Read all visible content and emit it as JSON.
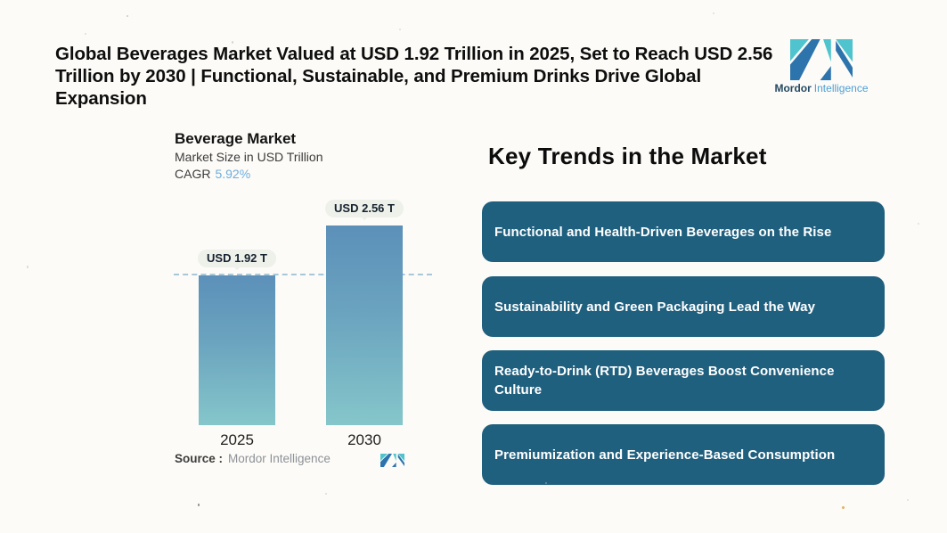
{
  "header": {
    "title_lines": [
      "Global Beverages Market Valued at USD 1.92 Trillion in 2025, Set to Reach USD 2.56",
      "Trillion by 2030 | Functional, Sustainable, and Premium Drinks Drive Global Expansion"
    ],
    "logo": {
      "word1": "Mordor",
      "word2": "Intelligence"
    }
  },
  "chart": {
    "title": "Beverage Market",
    "subtitle": "Market Size in USD Trillion",
    "cagr_label": "CAGR",
    "cagr_value": "5.92%",
    "bars": [
      {
        "year": "2025",
        "label": "USD 1.92 T"
      },
      {
        "year": "2030",
        "label": "USD 2.56 T"
      }
    ],
    "source_label": "Source :",
    "source_value": "Mordor Intelligence"
  },
  "trends": {
    "heading": "Key Trends in the Market",
    "items": [
      "Functional and Health-Driven Beverages on the Rise",
      "Sustainability and Green Packaging Lead the Way",
      "Ready-to-Drink (RTD) Beverages Boost Convenience Culture",
      "Premiumization and Experience-Based Consumption"
    ]
  },
  "chart_data": {
    "type": "bar",
    "title": "Beverage Market",
    "subtitle": "Market Size in USD Trillion",
    "cagr": "5.92%",
    "unit": "USD Trillion",
    "categories": [
      "2025",
      "2030"
    ],
    "values": [
      1.92,
      2.56
    ],
    "data_labels": [
      "USD 1.92 T",
      "USD 2.56 T"
    ],
    "reference_line": 1.92,
    "ylim": [
      0,
      2.94
    ],
    "grid": "off",
    "legend": "none"
  },
  "colors": {
    "background": "#fcfbf7",
    "card_background": "#20607f",
    "bar_gradient_top": "#5c90b9",
    "bar_gradient_bottom": "#85c6ca",
    "dashed_reference": "#a8c8da",
    "cagr_value": "#6fadde",
    "logo_blue": "#2d74ad",
    "logo_teal": "#4fc4ce"
  }
}
